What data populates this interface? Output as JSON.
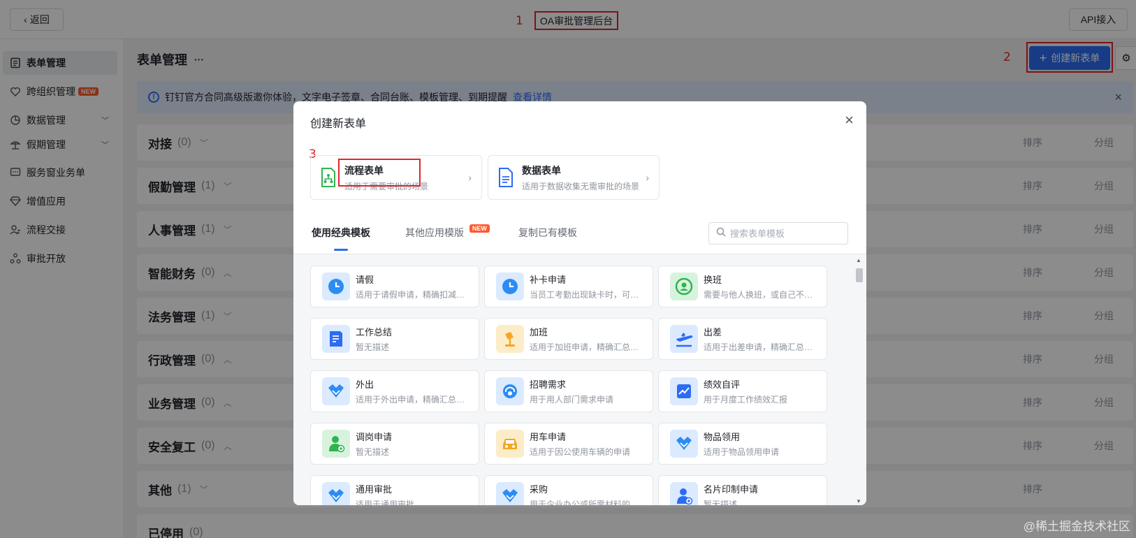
{
  "topbar": {
    "back_label": "返回",
    "title": "OA审批管理后台",
    "api_label": "API接入"
  },
  "annotations": {
    "one": "1",
    "two": "2",
    "three": "3"
  },
  "sidebar": {
    "items": [
      {
        "label": "表单管理",
        "icon": "form-icon"
      },
      {
        "label": "跨组织管理",
        "icon": "heart-icon",
        "badge": "NEW"
      },
      {
        "label": "数据管理",
        "icon": "data-icon"
      },
      {
        "label": "假期管理",
        "icon": "beach-icon"
      },
      {
        "label": "服务窗业务单",
        "icon": "chat-icon"
      },
      {
        "label": "增值应用",
        "icon": "diamond-icon"
      },
      {
        "label": "流程交接",
        "icon": "user-swap-icon"
      },
      {
        "label": "审批开放",
        "icon": "share-icon"
      }
    ]
  },
  "main": {
    "title": "表单管理",
    "more": "···",
    "create_label": "创建新表单",
    "notice": {
      "text": "钉钉官方合同高级版邀你体验，文字电子签章、合同台账、模板管理、到期提醒",
      "link": "查看详情"
    },
    "sort_label": "排序",
    "group_label": "分组",
    "groups": [
      {
        "name": "对接",
        "count": "(0)"
      },
      {
        "name": "假勤管理",
        "count": "(1)"
      },
      {
        "name": "人事管理",
        "count": "(1)"
      },
      {
        "name": "智能财务",
        "count": "(0)"
      },
      {
        "name": "法务管理",
        "count": "(1)"
      },
      {
        "name": "行政管理",
        "count": "(0)"
      },
      {
        "name": "业务管理",
        "count": "(0)"
      },
      {
        "name": "安全复工",
        "count": "(0)"
      },
      {
        "name": "其他",
        "count": "(1)"
      },
      {
        "name": "已停用",
        "count": "(0)"
      }
    ]
  },
  "modal": {
    "title": "创建新表单",
    "types": [
      {
        "title": "流程表单",
        "desc": "适用于需要审批的场景"
      },
      {
        "title": "数据表单",
        "desc": "适用于数据收集无需审批的场景"
      }
    ],
    "tabs": [
      {
        "label": "使用经典模板"
      },
      {
        "label": "其他应用模版",
        "badge": "NEW"
      },
      {
        "label": "复制已有模板"
      }
    ],
    "search_placeholder": "搜索表单模板",
    "templates": [
      {
        "name": "请假",
        "desc": "适用于请假申请，精确扣减假期余额",
        "icon": "clock-icon",
        "color": "#2c8cf4",
        "bg": "#dbeafe"
      },
      {
        "name": "补卡申请",
        "desc": "当员工考勤出现缺卡时，可提交补卡",
        "icon": "clock-icon",
        "color": "#2c8cf4",
        "bg": "#dbeafe"
      },
      {
        "name": "换班",
        "desc": "需要与他人换班，或自己不想上的班",
        "icon": "swap-user-icon",
        "color": "#31b352",
        "bg": "#d8f3dd"
      },
      {
        "name": "工作总结",
        "desc": "暂无描述",
        "icon": "document-icon",
        "color": "#2c6cf4",
        "bg": "#dbeafe"
      },
      {
        "name": "加班",
        "desc": "适用于加班申请，精确汇总加班时长",
        "icon": "lamp-icon",
        "color": "#f5a623",
        "bg": "#fdecc8"
      },
      {
        "name": "出差",
        "desc": "适用于出差申请，精确汇总出差时长",
        "icon": "plane-icon",
        "color": "#2c6cf4",
        "bg": "#dbeafe"
      },
      {
        "name": "外出",
        "desc": "适用于外出申请，精确汇总外出时长",
        "icon": "diamond-icon",
        "color": "#2c8cf4",
        "bg": "#dbeafe"
      },
      {
        "name": "招聘需求",
        "desc": "用于用人部门需求申请",
        "icon": "headset-icon",
        "color": "#2c8cf4",
        "bg": "#dbeafe"
      },
      {
        "name": "绩效自评",
        "desc": "用于月度工作绩效汇报",
        "icon": "chart-icon",
        "color": "#2c6cf4",
        "bg": "#dbeafe"
      },
      {
        "name": "调岗申请",
        "desc": "暂无描述",
        "icon": "person-icon",
        "color": "#31b352",
        "bg": "#d8f3dd"
      },
      {
        "name": "用车申请",
        "desc": "适用于因公使用车辆的申请",
        "icon": "car-icon",
        "color": "#f5a623",
        "bg": "#fdecc8"
      },
      {
        "name": "物品领用",
        "desc": "适用于物品领用申请",
        "icon": "diamond-icon",
        "color": "#2c8cf4",
        "bg": "#dbeafe"
      },
      {
        "name": "通用审批",
        "desc": "适用于通用审批",
        "icon": "diamond-icon",
        "color": "#2c8cf4",
        "bg": "#dbeafe"
      },
      {
        "name": "采购",
        "desc": "用于企业办公或所需材料的采购",
        "icon": "diamond-icon",
        "color": "#2c8cf4",
        "bg": "#dbeafe"
      },
      {
        "name": "名片印制申请",
        "desc": "暂无描述",
        "icon": "person-icon",
        "color": "#2c6cf4",
        "bg": "#dbeafe"
      }
    ]
  },
  "watermark": "@稀土掘金技术社区"
}
